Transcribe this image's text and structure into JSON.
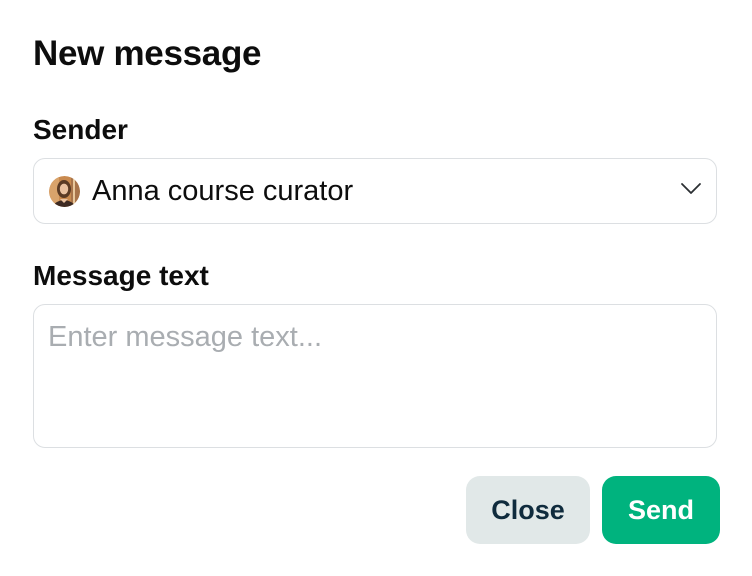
{
  "dialog": {
    "title": "New message"
  },
  "sender": {
    "label": "Sender",
    "selected_value": "Anna course curator",
    "avatar_icon": "user-avatar-photo",
    "dropdown_icon": "chevron-down-icon"
  },
  "message": {
    "label": "Message text",
    "placeholder": "Enter message text...",
    "value": ""
  },
  "actions": {
    "close_label": "Close",
    "send_label": "Send"
  },
  "colors": {
    "send_button_bg": "#00b37e",
    "close_button_bg": "#e1e8e8",
    "close_button_text": "#0f2b3d",
    "border": "#dcdfe2",
    "placeholder": "#a9adb1"
  }
}
